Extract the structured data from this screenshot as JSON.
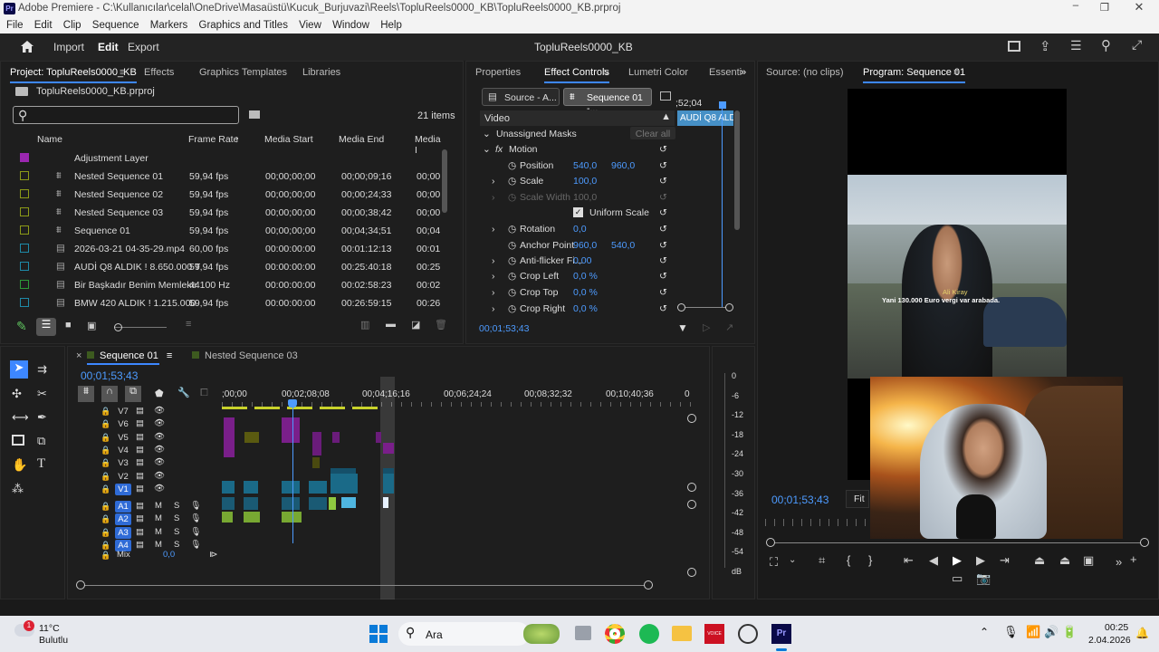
{
  "window": {
    "title": "Adobe Premiere - C:\\Kullanıcılar\\celal\\OneDrive\\Masaüstü\\Kucuk_Burjuvazi\\Reels\\TopluReels0000_KB\\TopluReels0000_KB.prproj",
    "app_icon": "Pr"
  },
  "menu": [
    "File",
    "Edit",
    "Clip",
    "Sequence",
    "Markers",
    "Graphics and Titles",
    "View",
    "Window",
    "Help"
  ],
  "appbar": {
    "import": "Import",
    "edit": "Edit",
    "export": "Export",
    "project_name": "TopluReels0000_KB"
  },
  "project": {
    "tabs": [
      "Project: TopluReels0000_KB",
      "Effects",
      "Graphics Templates",
      "Libraries"
    ],
    "file": "TopluReels0000_KB.prproj",
    "items_count": "21 items",
    "columns": [
      "Name",
      "Frame Rate",
      "Media Start",
      "Media End",
      "Media I"
    ],
    "rows": [
      {
        "name": "Adjustment Layer",
        "rate": "",
        "start": "",
        "end": "",
        "dur": "",
        "color": "#9b27b0"
      },
      {
        "name": "Nested Sequence 01",
        "rate": "59,94 fps",
        "start": "00;00;00;00",
        "end": "00;00;09;16",
        "dur": "00;00",
        "color": "#8c9a17"
      },
      {
        "name": "Nested Sequence 02",
        "rate": "59,94 fps",
        "start": "00;00;00;00",
        "end": "00;00;24;33",
        "dur": "00;00",
        "color": "#8c9a17"
      },
      {
        "name": "Nested Sequence 03",
        "rate": "59,94 fps",
        "start": "00;00;00;00",
        "end": "00;00;38;42",
        "dur": "00;00",
        "color": "#8c9a17"
      },
      {
        "name": "Sequence 01",
        "rate": "59,94 fps",
        "start": "00;00;00;00",
        "end": "00;04;34;51",
        "dur": "00;04",
        "color": "#8c9a17"
      },
      {
        "name": "2026-03-21 04-35-29.mp4",
        "rate": "60,00 fps",
        "start": "00:00:00:00",
        "end": "00:01:12:13",
        "dur": "00:01",
        "color": "#1e8aa8"
      },
      {
        "name": "AUDİ Q8 ALDIK ! 8.650.000 T",
        "rate": "59,94 fps",
        "start": "00:00:00:00",
        "end": "00:25:40:18",
        "dur": "00:25",
        "color": "#1e8aa8"
      },
      {
        "name": "Bir Başkadır Benim Memleke",
        "rate": "44100 Hz",
        "start": "00:00:00:00",
        "end": "00:02:58:23",
        "dur": "00:02",
        "color": "#2c9a37"
      },
      {
        "name": "BMW 420 ALDIK ! 1.215.000",
        "rate": "59,94 fps",
        "start": "00:00:00:00",
        "end": "00:26:59:15",
        "dur": "00:26",
        "color": "#1e8aa8"
      }
    ]
  },
  "effect_controls": {
    "tabs": [
      "Properties",
      "Effect Controls",
      "Lumetri Color",
      "Essenti"
    ],
    "source_btn": "Source - A...",
    "seq_btn": "Sequence 01 -...",
    "ruler_time": ";52;04",
    "clip_label": "AUDİ Q8 ALDI",
    "video": "Video",
    "masks": "Unassigned Masks",
    "clear_all": "Clear all",
    "motion": "Motion",
    "position_label": "Position",
    "position_x": "540,0",
    "position_y": "960,0",
    "scale_label": "Scale",
    "scale": "100,0",
    "scale_width_label": "Scale Width",
    "scale_width": "100,0",
    "uniform": "Uniform Scale",
    "rotation_label": "Rotation",
    "rotation": "0,0",
    "anchor_label": "Anchor Point",
    "anchor_x": "960,0",
    "anchor_y": "540,0",
    "antiflicker_label": "Anti-flicker Fi...",
    "antiflicker": "0,00",
    "crop_left_label": "Crop Left",
    "crop_left": "0,0 %",
    "crop_top_label": "Crop Top",
    "crop_top": "0,0 %",
    "crop_right_label": "Crop Right",
    "crop_right": "0,0 %",
    "timecode": "00;01;53;43"
  },
  "source": {
    "tab": "Source: (no clips)"
  },
  "program": {
    "tab": "Program: Sequence 01",
    "caption_name": "Ali Kiray",
    "caption_text": "Yani 130.000 Euro vergi var arabada.",
    "timecode": "00;01;53;43",
    "fit": "Fit"
  },
  "timeline": {
    "tabs": [
      "Sequence 01",
      "Nested Sequence 03"
    ],
    "timecode": "00;01;53;43",
    "ruler": [
      ";00;00",
      "00;02;08;08",
      "00;04;16;16",
      "00;06;24;24",
      "00;08;32;32",
      "00;10;40;36",
      "0"
    ],
    "video_tracks": [
      "V7",
      "V6",
      "V5",
      "V4",
      "V3",
      "V2",
      "V1"
    ],
    "audio_tracks": [
      "A1",
      "A2",
      "A3",
      "A4"
    ],
    "mix": "Mix",
    "mix_value": "0,0",
    "meter": [
      "0",
      "-6",
      "-12",
      "-18",
      "-24",
      "-30",
      "-36",
      "-42",
      "-48",
      "-54",
      "dB"
    ]
  },
  "taskbar": {
    "weather_temp": "11°C",
    "weather_text": "Bulutlu",
    "search": "Ara",
    "badge": "1",
    "time": "00:25",
    "date": "2.04.2026"
  }
}
